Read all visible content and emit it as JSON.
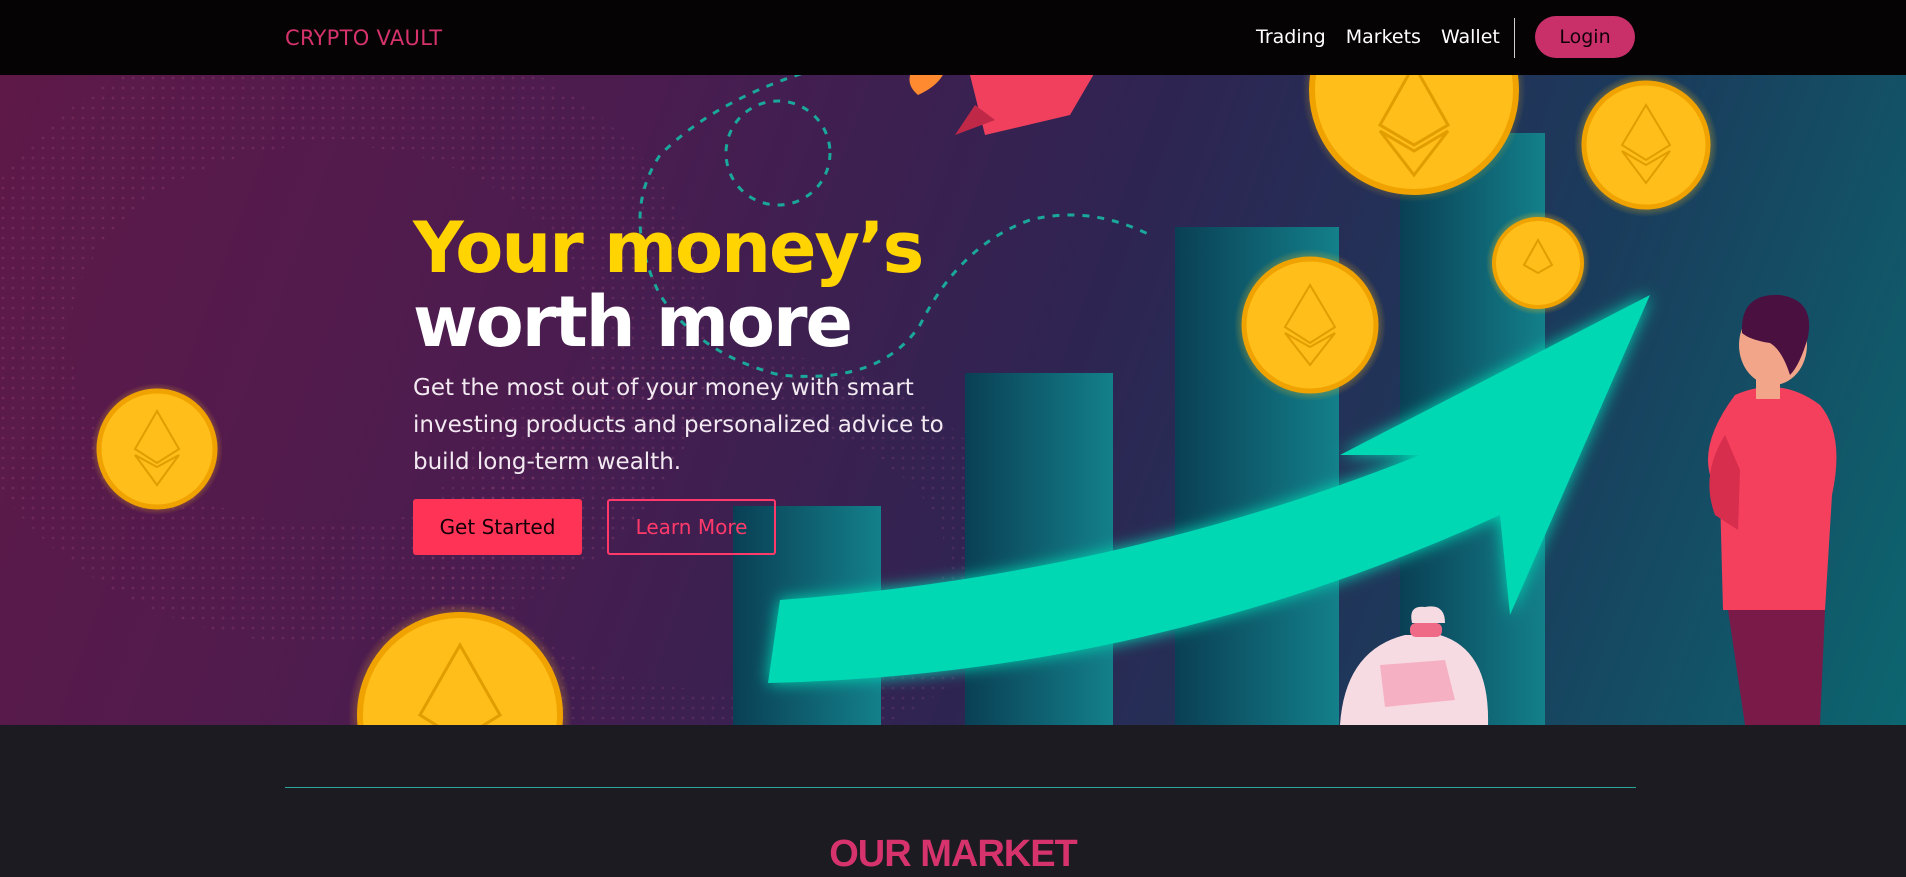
{
  "navbar": {
    "brand": "CRYPTO VAULT",
    "links": [
      "Trading",
      "Markets",
      "Wallet"
    ],
    "login_label": "Login"
  },
  "hero": {
    "title_line1": "Your money’s",
    "title_line2": "worth more",
    "description": "Get the most out of your money with smart investing products and personalized advice to build long-term wealth.",
    "primary_button": "Get Started",
    "secondary_button": "Learn More",
    "illustration": {
      "icons": [
        "ethereum-coin-icon",
        "rocket-icon",
        "money-bag-icon",
        "growth-arrow-icon",
        "person-figure"
      ],
      "colors": {
        "coin": "#ffc21a",
        "bars": "#0e6a78",
        "arrow": "#00d8b4",
        "person_shirt": "#f5405d"
      }
    }
  },
  "market": {
    "title": "OUR MARKET"
  },
  "colors": {
    "accent": "#d6336c",
    "title_yellow": "#ffd400",
    "button_red": "#ff3355",
    "divider_teal": "#2aa69a"
  }
}
